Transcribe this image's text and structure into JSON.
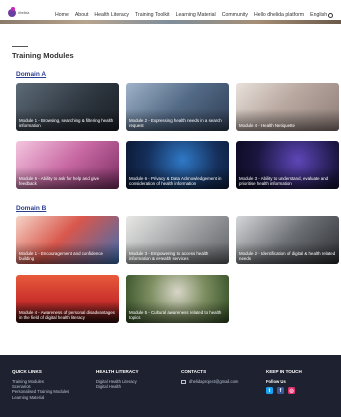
{
  "header": {
    "logo_text": "dhelida",
    "nav": [
      "Home",
      "About",
      "Health Literacy",
      "Training Toolkit",
      "Learning Material",
      "Community",
      "Hello dhelida platform",
      "English"
    ]
  },
  "page": {
    "title": "Training Modules"
  },
  "domains": [
    {
      "label": "Domain A",
      "modules": [
        {
          "caption": "Module 1 - Browsing, searching & filtering health information",
          "color": "#3a4652"
        },
        {
          "caption": "Module 2 - Expressing health needs in a search request",
          "color": "#5a6f8a"
        },
        {
          "caption": "Module 4 - Health Netiquette",
          "color": "#b8a9a1"
        },
        {
          "caption": "Module 5 - Ability to ask for help and give feedback",
          "color": "#b95c91"
        },
        {
          "caption": "Module 6 - Privacy & Data Acknowledgement in consideration of health information",
          "color": "#15305c"
        },
        {
          "caption": "Module 3 - Ability to understand, evaluate and prioritise health information",
          "color": "#1a1640"
        }
      ]
    },
    {
      "label": "Domain B",
      "modules": [
        {
          "caption": "Module 1 - Encouragement and confidence building",
          "color": "#c2403a"
        },
        {
          "caption": "Module 3 - Empowering to access health information & eHealth services",
          "color": "#8f9194"
        },
        {
          "caption": "Module 2 - Identification of digital & health related needs",
          "color": "#4a4d52"
        },
        {
          "caption": "Module 4 - Awareness of personal disadvantages in the field of digital health literacy",
          "color": "#c9302c"
        },
        {
          "caption": "Module 5 - Cultural awareness related to health topics",
          "color": "#3f6b2f"
        }
      ]
    }
  ],
  "footer": {
    "quick_links": {
      "title": "QUICK LINKS",
      "items": [
        "Training Modules",
        "Scenarios",
        "Personalised Training Modules",
        "Learning Material"
      ]
    },
    "health_literacy": {
      "title": "HEALTH LITERACY",
      "items": [
        "Digital Health Literacy",
        "Digital Health"
      ]
    },
    "contacts": {
      "title": "CONTACTS",
      "email": "dhelidaproject@gmail.com"
    },
    "keep_in_touch": {
      "title": "KEEP IN TOUCH",
      "follow": "Follow Us"
    },
    "social_colors": {
      "twitter": "#1da1f2",
      "facebook": "#3b5998",
      "instagram": "#e1306c"
    }
  }
}
